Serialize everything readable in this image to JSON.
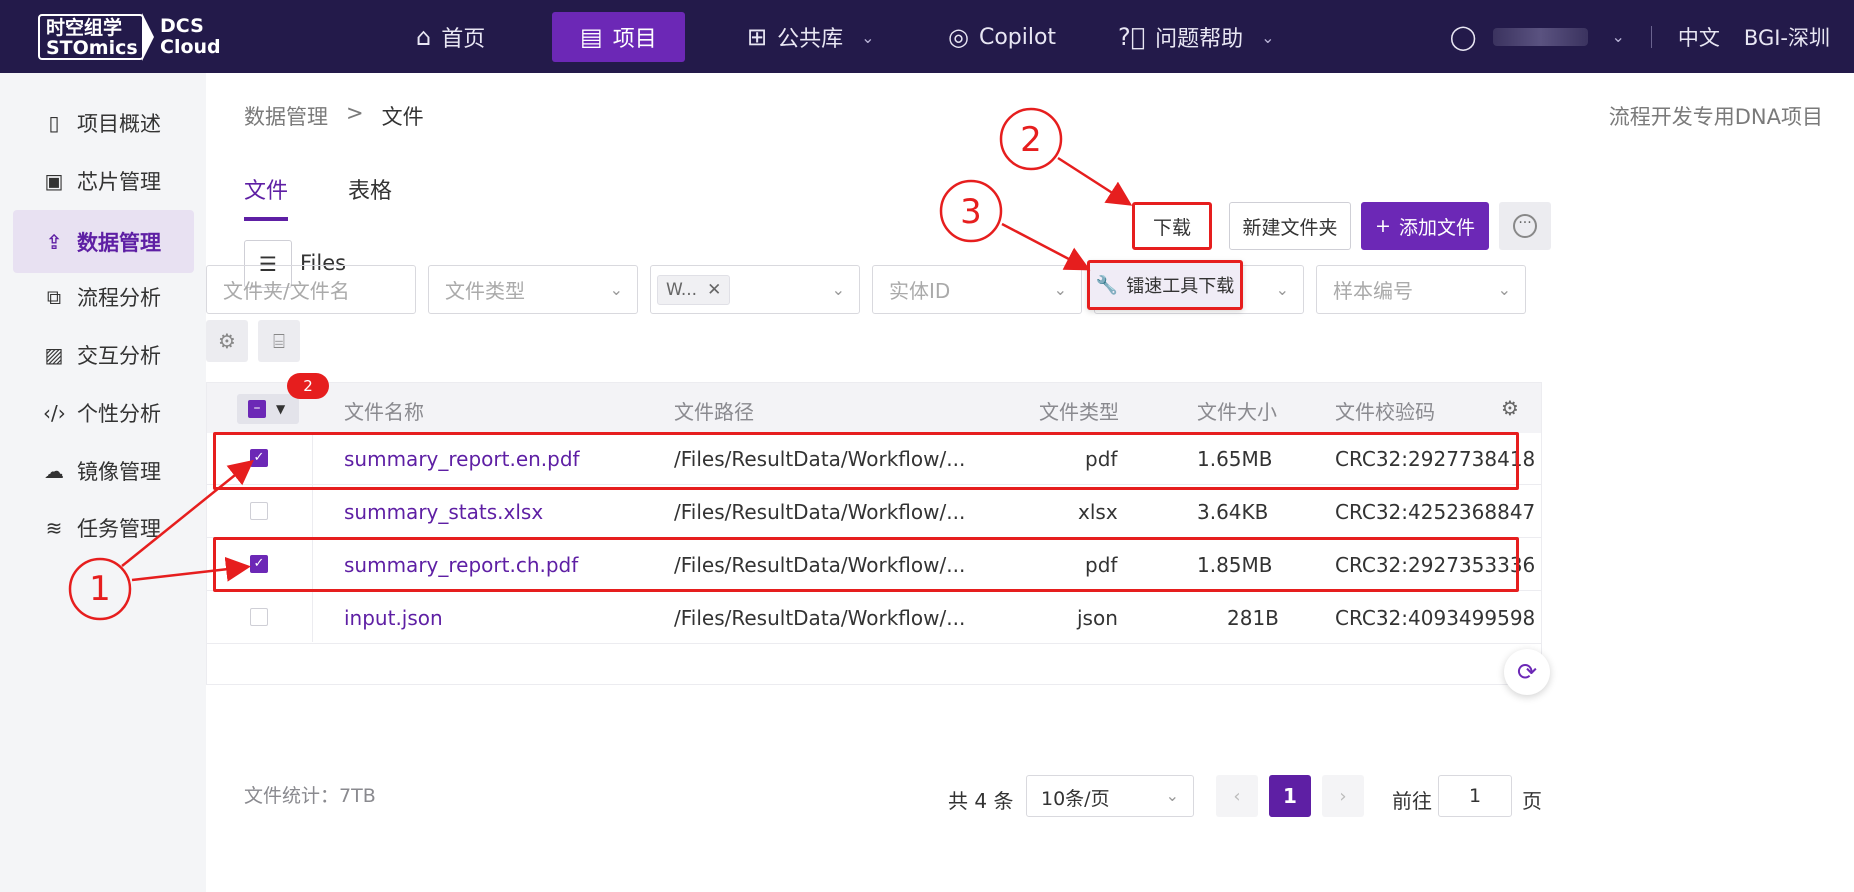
{
  "logo": {
    "line1": "时空组学",
    "line2": "STOmics",
    "dcs1": "DCS",
    "dcs2": "Cloud"
  },
  "nav": {
    "items": [
      {
        "label": "首页",
        "icon": "home-icon"
      },
      {
        "label": "项目",
        "icon": "document-icon"
      },
      {
        "label": "公共库",
        "icon": "grid-icon"
      },
      {
        "label": "Copilot",
        "icon": "copilot-icon"
      },
      {
        "label": "问题帮助",
        "icon": "help-icon"
      }
    ],
    "language": "中文",
    "region": "BGI-深圳"
  },
  "sidebar": {
    "items": [
      {
        "label": "项目概述",
        "icon": "file-text-icon"
      },
      {
        "label": "芯片管理",
        "icon": "chip-icon"
      },
      {
        "label": "数据管理",
        "icon": "data-upload-icon"
      },
      {
        "label": "流程分析",
        "icon": "flow-icon"
      },
      {
        "label": "交互分析",
        "icon": "image-icon"
      },
      {
        "label": "个性分析",
        "icon": "code-icon"
      },
      {
        "label": "镜像管理",
        "icon": "docker-icon"
      },
      {
        "label": "任务管理",
        "icon": "layers-icon"
      }
    ]
  },
  "breadcrumb": {
    "parent": "数据管理",
    "sep": ">",
    "current": "文件"
  },
  "project_name": "流程开发专用DNA项目",
  "tabs": [
    {
      "label": "文件"
    },
    {
      "label": "表格"
    }
  ],
  "files_label": "Files",
  "toolbar": {
    "download": "下载",
    "new_folder": "新建文件夹",
    "add_file": "添加文件",
    "add_icon": "+",
    "accel_download": "镭速工具下载"
  },
  "filters": {
    "name_placeholder": "文件夹/文件名",
    "type_placeholder": "文件类型",
    "tag_value": "W...",
    "entity_placeholder": "实体ID",
    "sample_placeholder": "样本编号"
  },
  "table": {
    "selected_count": "2",
    "headers": [
      "文件名称",
      "文件路径",
      "文件类型",
      "文件大小",
      "文件校验码"
    ],
    "rows": [
      {
        "name": "summary_report.en.pdf",
        "path": "/Files/ResultData/Workflow/...",
        "type": "pdf",
        "size": "1.65MB",
        "checksum": "CRC32:2927738418",
        "checked": true
      },
      {
        "name": "summary_stats.xlsx",
        "path": "/Files/ResultData/Workflow/...",
        "type": "xlsx",
        "size": "3.64KB",
        "checksum": "CRC32:4252368847",
        "checked": false
      },
      {
        "name": "summary_report.ch.pdf",
        "path": "/Files/ResultData/Workflow/...",
        "type": "pdf",
        "size": "1.85MB",
        "checksum": "CRC32:2927353336",
        "checked": true
      },
      {
        "name": "input.json",
        "path": "/Files/ResultData/Workflow/...",
        "type": "json",
        "size": "281B",
        "checksum": "CRC32:4093499598",
        "checked": false
      }
    ]
  },
  "footer": {
    "stats": "文件统计：7TB",
    "total": "共 4 条",
    "page_size": "10条/页",
    "current_page": "1",
    "goto_label": "前往",
    "goto_value": "1",
    "page_suffix": "页"
  },
  "annotations": {
    "n1": "1",
    "n2": "2",
    "n3": "3"
  },
  "colors": {
    "accent": "#6c28b6",
    "nav_bg": "#231a4a",
    "annotation": "#e61e1e"
  }
}
